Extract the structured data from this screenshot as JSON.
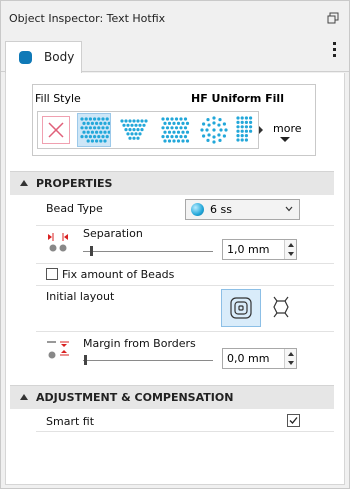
{
  "window": {
    "title": "Object Inspector: Text Hotfix",
    "restore_icon": "restore-window-icon",
    "menu_icon": "more-vertical-icon"
  },
  "tab": {
    "label": "Body",
    "color": "#0f79b7"
  },
  "fill_style": {
    "label": "Fill Style",
    "value": "HF Uniform Fill",
    "items": [
      "none-icon",
      "uniform-fill-icon",
      "pattern-fill-icon",
      "dots-fill-icon",
      "spiral-fill-icon",
      "partial-fill-icon"
    ],
    "selected_index": 1,
    "more_label": "more"
  },
  "sections": {
    "properties": "PROPERTIES",
    "adjustment": "ADJUSTMENT & COMPENSATION"
  },
  "properties": {
    "bead_type_label": "Bead Type",
    "bead_type_value": "6 ss",
    "separation_label": "Separation",
    "separation_value": "1,0 mm",
    "fix_amount_label": "Fix amount of Beads",
    "fix_amount_checked": false,
    "initial_layout_label": "Initial layout",
    "initial_layout_options": [
      "spiral-layout-icon",
      "hexagon-layout-icon"
    ],
    "initial_layout_selected": 0,
    "margin_label": "Margin from Borders",
    "margin_value": "0,0 mm"
  },
  "adjustment": {
    "smart_fit_label": "Smart fit",
    "smart_fit_checked": true
  },
  "colors": {
    "accent": "#0f79b7",
    "bead": "#22a7d9",
    "red_marker": "#d92020"
  }
}
